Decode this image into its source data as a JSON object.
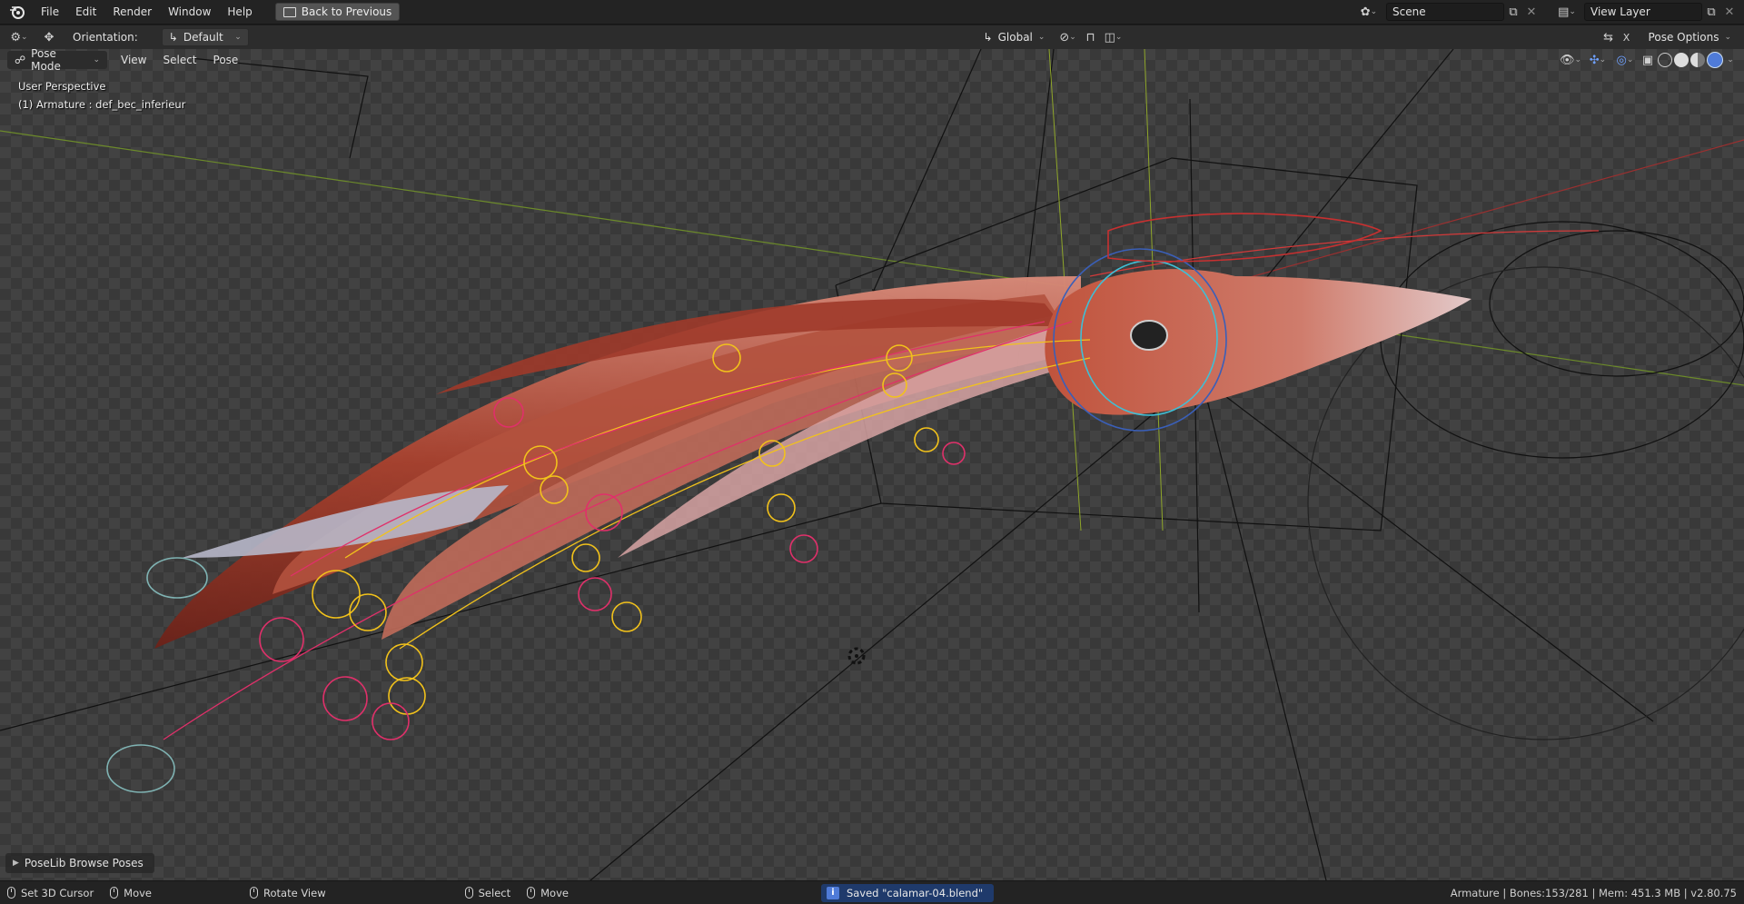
{
  "topbar": {
    "menus": [
      "File",
      "Edit",
      "Render",
      "Window",
      "Help"
    ],
    "back_button": "Back to Previous",
    "scene_name": "Scene",
    "view_layer": "View Layer"
  },
  "tool_header": {
    "orientation_label": "Orientation:",
    "orientation_value": "Default",
    "transform_orientation": "Global",
    "pose_options": "Pose Options"
  },
  "viewport_header": {
    "mode": "Pose Mode",
    "menus": [
      "View",
      "Select",
      "Pose"
    ]
  },
  "viewport": {
    "perspective": "User Perspective",
    "active_object": "(1) Armature : def_bec_inferieur",
    "poselib_panel": "PoseLib Browse Poses"
  },
  "statusbar": {
    "left_actions": [
      {
        "label": "Set 3D Cursor"
      },
      {
        "label": "Move"
      },
      {
        "label": "Rotate View"
      },
      {
        "label": "Select"
      },
      {
        "label": "Move"
      }
    ],
    "saved_message": "Saved \"calamar-04.blend\"",
    "stats": "Armature | Bones:153/281 | Mem: 451.3 MB | v2.80.75"
  },
  "colors": {
    "accent": "#4f7bd8",
    "squid_body": "#b24a34",
    "bone_yellow": "#f2c21b",
    "bone_pink": "#e0306a"
  }
}
